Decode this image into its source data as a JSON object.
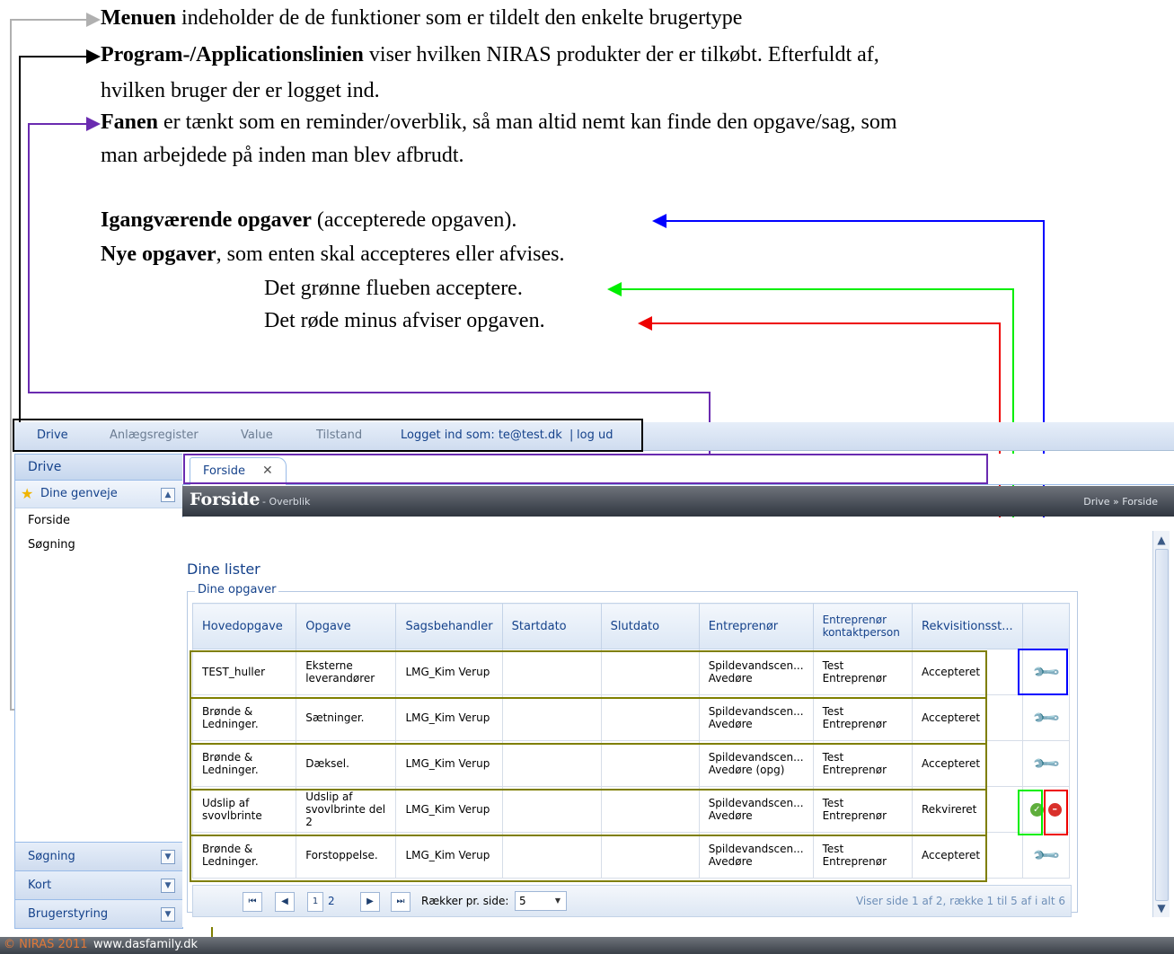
{
  "annotations": {
    "line1_bold": "Menuen",
    "line1_rest": " indeholder de de funktioner som er tildelt den enkelte brugertype",
    "line2_bold": "Program-/Applicationslinien",
    "line2_rest": " viser hvilken NIRAS produkter der er tilkøbt. Efterfuldt af,",
    "line3": "hvilken bruger der er logget ind.",
    "line4_bold": "Fanen",
    "line4_rest": " er tænkt som en reminder/overblik, så man altid nemt kan finde den opgave/sag, som",
    "line5": "man arbejdede på inden man blev afbrudt.",
    "line6_bold": "Igangværende opgaver",
    "line6_rest": " (accepterede opgaven).",
    "line7_bold": "Nye opgaver",
    "line7_rest": ", som enten skal accepteres eller afvises.",
    "line8": "Det grønne flueben acceptere.",
    "line9": "Det røde minus afviser opgaven."
  },
  "menubar": {
    "drive": "Drive",
    "anlaeg": "Anlægsregister",
    "value": "Value",
    "tilstand": "Tilstand",
    "logged_in": "Logget ind som: te@test.dk",
    "separator": "|",
    "logout": "log ud"
  },
  "sidebar": {
    "title": "Drive",
    "shortcuts_header": "Dine genveje",
    "links": [
      "Forside",
      "Søgning"
    ],
    "sections": [
      "Søgning",
      "Kort",
      "Brugerstyring"
    ]
  },
  "tab": {
    "label": "Forside",
    "close": "✕"
  },
  "header": {
    "title": "Forside",
    "subtitle": "- Overblik",
    "breadcrumb": "Drive » Forside"
  },
  "content": {
    "lists_title": "Dine lister",
    "tasks_legend": "Dine opgaver",
    "columns": [
      "Hovedopgave",
      "Opgave",
      "Sagsbehandler",
      "Startdato",
      "Slutdato",
      "Entreprenør",
      "Entreprenør kontaktperson",
      "Rekvisitionsst..."
    ],
    "rows": [
      [
        "TEST_huller",
        "Eksterne leverandører",
        "LMG_Kim Verup",
        "",
        "",
        "Spildevandscen... Avedøre",
        "Test Entreprenør",
        "Accepteret"
      ],
      [
        "Brønde & Ledninger.",
        "Sætninger.",
        "LMG_Kim Verup",
        "",
        "",
        "Spildevandscen... Avedøre",
        "Test Entreprenør",
        "Accepteret"
      ],
      [
        "Brønde & Ledninger.",
        "Dæksel.",
        "LMG_Kim Verup",
        "",
        "",
        "Spildevandscen... Avedøre (opg)",
        "Test Entreprenør",
        "Accepteret"
      ],
      [
        "Udslip af svovlbrinte",
        "Udslip af svovlbrinte del 2",
        "LMG_Kim Verup",
        "",
        "",
        "Spildevandscen... Avedøre",
        "Test Entreprenør",
        "Rekvireret"
      ],
      [
        "Brønde & Ledninger.",
        "Forstoppelse.",
        "LMG_Kim Verup",
        "",
        "",
        "Spildevandscen... Avedøre",
        "Test Entreprenør",
        "Accepteret"
      ]
    ],
    "row_actions": [
      "wrench-icon",
      "wrench-icon",
      "wrench-icon",
      "accept-reject",
      "wrench-icon"
    ]
  },
  "pager": {
    "first": "⏮",
    "prev": "◀",
    "page1": "1",
    "page2": "2",
    "next": "▶",
    "last": "⏭",
    "rows_per_page_label": "Rækker pr. side:",
    "rows_per_page_value": "5",
    "summary": "Viser side 1 af 2, række 1 til 5 af i alt 6"
  },
  "footer": {
    "copyright": "© NIRAS 2011",
    "url": "www.dasfamily.dk"
  },
  "colors": {
    "accent": "#15428b",
    "blue_callout": "#0000ff",
    "green_callout": "#00ee00",
    "red_callout": "#ee0000",
    "purple_callout": "#6a2bb0",
    "olive_callout": "#7f7f00",
    "gray_arrow": "#b0b0b0"
  }
}
